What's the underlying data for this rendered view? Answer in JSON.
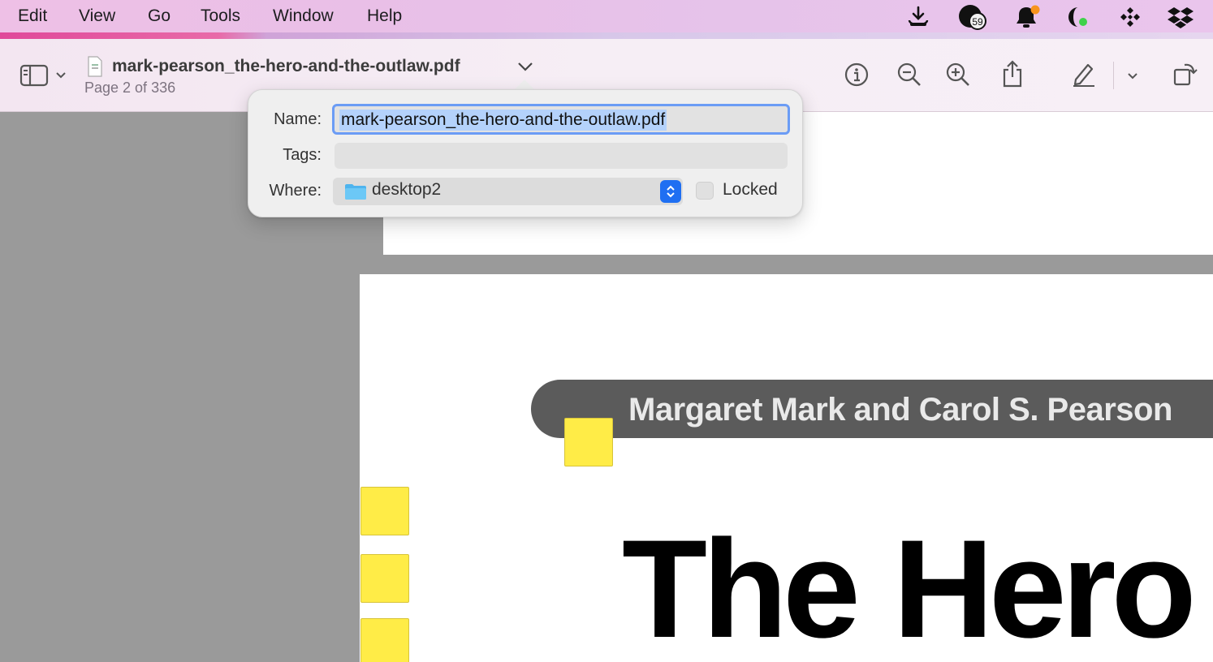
{
  "menubar": {
    "items": [
      "Edit",
      "View",
      "Go",
      "Tools",
      "Window",
      "Help"
    ],
    "status_icons": [
      "download-tray-icon",
      "notification-count-icon",
      "bell-alert-icon",
      "activity-indicator-icon",
      "app-grid-icon",
      "dropbox-icon"
    ],
    "badge_count": "59"
  },
  "toolbar": {
    "document_name": "mark-pearson_the-hero-and-the-outlaw.pdf",
    "page_info": "Page 2 of 336",
    "icons": [
      "sidebar-icon",
      "chevron-down-icon",
      "info-icon",
      "zoom-out-icon",
      "zoom-in-icon",
      "share-icon",
      "markup-pen-icon",
      "chevron-down-icon",
      "rotate-icon"
    ]
  },
  "rename_popover": {
    "name_label": "Name:",
    "name_value": "mark-pearson_the-hero-and-the-outlaw.pdf",
    "tags_label": "Tags:",
    "tags_value": "",
    "where_label": "Where:",
    "where_value": "desktop2",
    "locked_label": "Locked",
    "locked_checked": false
  },
  "document": {
    "author": "Margaret Mark and Carol S. Pearson",
    "title_words": [
      "The",
      "Hero"
    ]
  },
  "colors": {
    "note_yellow": "#ffec47",
    "accent_blue": "#1f6ff2",
    "selection": "#b4d2fb"
  }
}
